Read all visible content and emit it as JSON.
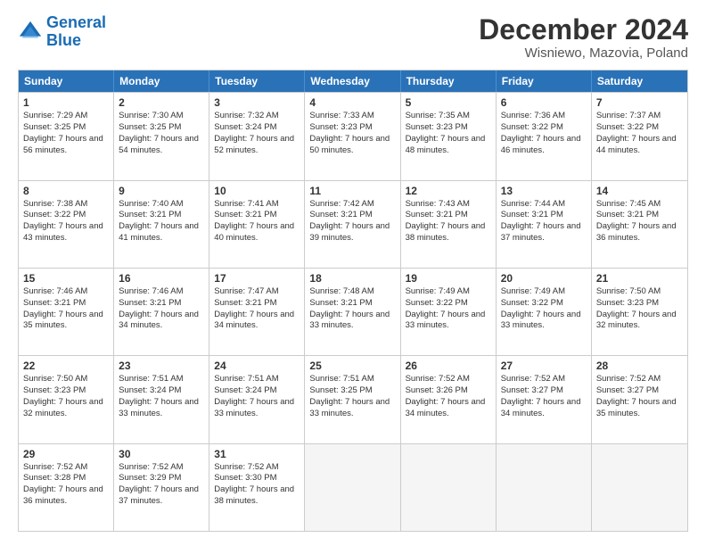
{
  "logo": {
    "line1": "General",
    "line2": "Blue"
  },
  "title": "December 2024",
  "subtitle": "Wisniewo, Mazovia, Poland",
  "days": [
    "Sunday",
    "Monday",
    "Tuesday",
    "Wednesday",
    "Thursday",
    "Friday",
    "Saturday"
  ],
  "weeks": [
    [
      {
        "date": "1",
        "sunrise": "7:29 AM",
        "sunset": "3:25 PM",
        "daylight": "7 hours and 56 minutes."
      },
      {
        "date": "2",
        "sunrise": "7:30 AM",
        "sunset": "3:25 PM",
        "daylight": "7 hours and 54 minutes."
      },
      {
        "date": "3",
        "sunrise": "7:32 AM",
        "sunset": "3:24 PM",
        "daylight": "7 hours and 52 minutes."
      },
      {
        "date": "4",
        "sunrise": "7:33 AM",
        "sunset": "3:23 PM",
        "daylight": "7 hours and 50 minutes."
      },
      {
        "date": "5",
        "sunrise": "7:35 AM",
        "sunset": "3:23 PM",
        "daylight": "7 hours and 48 minutes."
      },
      {
        "date": "6",
        "sunrise": "7:36 AM",
        "sunset": "3:22 PM",
        "daylight": "7 hours and 46 minutes."
      },
      {
        "date": "7",
        "sunrise": "7:37 AM",
        "sunset": "3:22 PM",
        "daylight": "7 hours and 44 minutes."
      }
    ],
    [
      {
        "date": "8",
        "sunrise": "7:38 AM",
        "sunset": "3:22 PM",
        "daylight": "7 hours and 43 minutes."
      },
      {
        "date": "9",
        "sunrise": "7:40 AM",
        "sunset": "3:21 PM",
        "daylight": "7 hours and 41 minutes."
      },
      {
        "date": "10",
        "sunrise": "7:41 AM",
        "sunset": "3:21 PM",
        "daylight": "7 hours and 40 minutes."
      },
      {
        "date": "11",
        "sunrise": "7:42 AM",
        "sunset": "3:21 PM",
        "daylight": "7 hours and 39 minutes."
      },
      {
        "date": "12",
        "sunrise": "7:43 AM",
        "sunset": "3:21 PM",
        "daylight": "7 hours and 38 minutes."
      },
      {
        "date": "13",
        "sunrise": "7:44 AM",
        "sunset": "3:21 PM",
        "daylight": "7 hours and 37 minutes."
      },
      {
        "date": "14",
        "sunrise": "7:45 AM",
        "sunset": "3:21 PM",
        "daylight": "7 hours and 36 minutes."
      }
    ],
    [
      {
        "date": "15",
        "sunrise": "7:46 AM",
        "sunset": "3:21 PM",
        "daylight": "7 hours and 35 minutes."
      },
      {
        "date": "16",
        "sunrise": "7:46 AM",
        "sunset": "3:21 PM",
        "daylight": "7 hours and 34 minutes."
      },
      {
        "date": "17",
        "sunrise": "7:47 AM",
        "sunset": "3:21 PM",
        "daylight": "7 hours and 34 minutes."
      },
      {
        "date": "18",
        "sunrise": "7:48 AM",
        "sunset": "3:21 PM",
        "daylight": "7 hours and 33 minutes."
      },
      {
        "date": "19",
        "sunrise": "7:49 AM",
        "sunset": "3:22 PM",
        "daylight": "7 hours and 33 minutes."
      },
      {
        "date": "20",
        "sunrise": "7:49 AM",
        "sunset": "3:22 PM",
        "daylight": "7 hours and 33 minutes."
      },
      {
        "date": "21",
        "sunrise": "7:50 AM",
        "sunset": "3:23 PM",
        "daylight": "7 hours and 32 minutes."
      }
    ],
    [
      {
        "date": "22",
        "sunrise": "7:50 AM",
        "sunset": "3:23 PM",
        "daylight": "7 hours and 32 minutes."
      },
      {
        "date": "23",
        "sunrise": "7:51 AM",
        "sunset": "3:24 PM",
        "daylight": "7 hours and 33 minutes."
      },
      {
        "date": "24",
        "sunrise": "7:51 AM",
        "sunset": "3:24 PM",
        "daylight": "7 hours and 33 minutes."
      },
      {
        "date": "25",
        "sunrise": "7:51 AM",
        "sunset": "3:25 PM",
        "daylight": "7 hours and 33 minutes."
      },
      {
        "date": "26",
        "sunrise": "7:52 AM",
        "sunset": "3:26 PM",
        "daylight": "7 hours and 34 minutes."
      },
      {
        "date": "27",
        "sunrise": "7:52 AM",
        "sunset": "3:27 PM",
        "daylight": "7 hours and 34 minutes."
      },
      {
        "date": "28",
        "sunrise": "7:52 AM",
        "sunset": "3:27 PM",
        "daylight": "7 hours and 35 minutes."
      }
    ],
    [
      {
        "date": "29",
        "sunrise": "7:52 AM",
        "sunset": "3:28 PM",
        "daylight": "7 hours and 36 minutes."
      },
      {
        "date": "30",
        "sunrise": "7:52 AM",
        "sunset": "3:29 PM",
        "daylight": "7 hours and 37 minutes."
      },
      {
        "date": "31",
        "sunrise": "7:52 AM",
        "sunset": "3:30 PM",
        "daylight": "7 hours and 38 minutes."
      },
      null,
      null,
      null,
      null
    ]
  ]
}
